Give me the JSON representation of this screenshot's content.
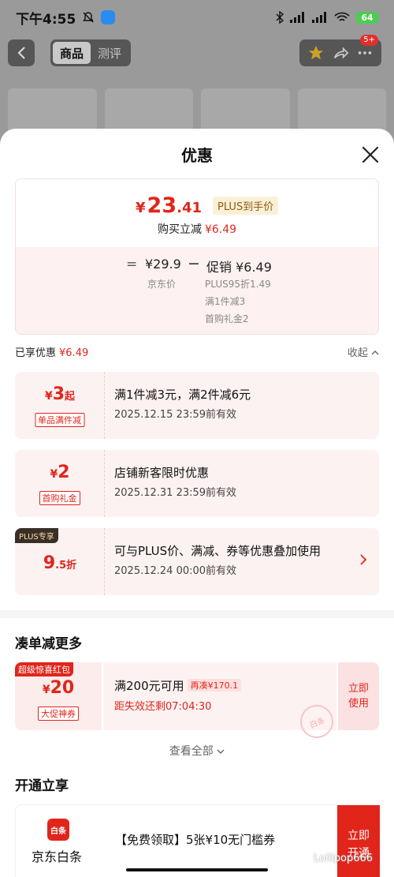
{
  "statusbar": {
    "time": "下午4:55",
    "battery": "64"
  },
  "nav": {
    "tabs": [
      "商品",
      "测评"
    ],
    "badge": "5+"
  },
  "sheet": {
    "title": "优惠",
    "price": {
      "yen": "¥",
      "int": "23",
      "dec": ".41",
      "plus_tag": "PLUS到手价"
    },
    "save": {
      "label": "购买立减",
      "amount": "¥6.49"
    },
    "calc": {
      "eq": "=",
      "orig_price": "¥29.9",
      "minus": "−",
      "promo_price": "促销 ¥6.49",
      "orig_label": "京东价",
      "promo_details": [
        "PLUS95折1.49",
        "满1件减3",
        "首购礼金2"
      ]
    },
    "enjoy": {
      "label": "已享优惠",
      "amount": "¥6.49",
      "collapse": "收起"
    },
    "coupons": [
      {
        "yen": "¥",
        "num": "3",
        "unit": "起",
        "tag": "单品满件减",
        "title": "满1件减3元，满2件减6元",
        "expire": "2025.12.15 23:59前有效"
      },
      {
        "yen": "¥",
        "num": "2",
        "unit": "",
        "tag": "首购礼金",
        "title": "店铺新客限时优惠",
        "expire": "2025.12.31 23:59前有效"
      },
      {
        "corner": "PLUS专享",
        "num": "9",
        "unit": ".5折",
        "title": "可与PLUS价、满减、券等优惠叠加使用",
        "expire": "2025.12.24 00:00前有效"
      }
    ],
    "more": {
      "title": "凑单减更多",
      "packet": {
        "badge": "超级惊喜红包",
        "yen": "¥",
        "num": "20",
        "tag": "大促神券",
        "title": "满200元可用",
        "chip": "再凑¥170.1",
        "timer": "距失效还剩07:04:30",
        "stamp": "白条",
        "action": "立即使用"
      },
      "view_all": "查看全部"
    },
    "open": {
      "title": "开通立享",
      "icon_text": "白条",
      "name": "京东白条",
      "desc": "【免费领取】5张¥10无门槛券",
      "action": "立即开通"
    }
  },
  "watermark": "Lollipop666",
  "colors": {
    "accent": "#e1251b",
    "plus_bg": "#fbf0d6",
    "coupon_bg": "#fdf2f2"
  }
}
